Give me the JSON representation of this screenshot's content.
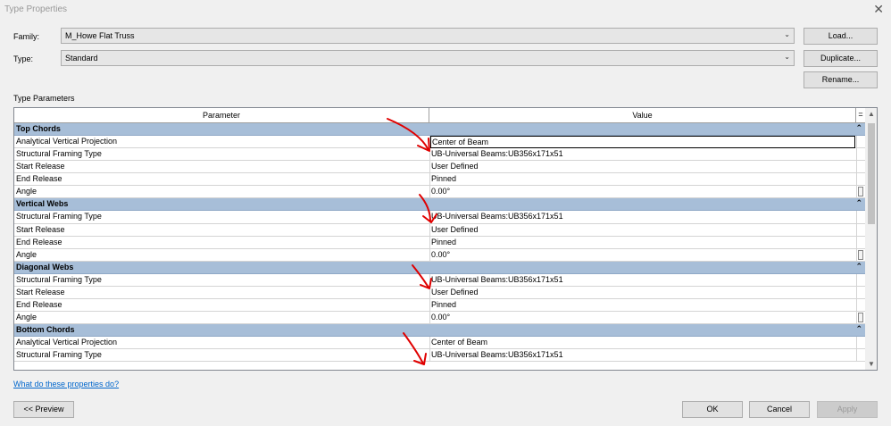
{
  "window": {
    "title": "Type Properties"
  },
  "family": {
    "label": "Family:",
    "value": "M_Howe Flat Truss",
    "load_label": "Load..."
  },
  "type": {
    "label": "Type:",
    "value": "Standard",
    "duplicate_label": "Duplicate...",
    "rename_label": "Rename..."
  },
  "type_parameters_caption": "Type Parameters",
  "grid": {
    "param_header": "Parameter",
    "value_header": "Value",
    "menu_glyph": "=",
    "groups": [
      {
        "name": "Top Chords",
        "rows": [
          {
            "param": "Analytical Vertical Projection",
            "value": "Center of Beam"
          },
          {
            "param": "Structural Framing Type",
            "value": "UB-Universal Beams:UB356x171x51"
          },
          {
            "param": "Start Release",
            "value": "User Defined"
          },
          {
            "param": "End Release",
            "value": "Pinned"
          },
          {
            "param": "Angle",
            "value": "0.00°"
          }
        ]
      },
      {
        "name": "Vertical Webs",
        "rows": [
          {
            "param": "Structural Framing Type",
            "value": "UB-Universal Beams:UB356x171x51"
          },
          {
            "param": "Start Release",
            "value": "User Defined"
          },
          {
            "param": "End Release",
            "value": "Pinned"
          },
          {
            "param": "Angle",
            "value": "0.00°"
          }
        ]
      },
      {
        "name": "Diagonal Webs",
        "rows": [
          {
            "param": "Structural Framing Type",
            "value": "UB-Universal Beams:UB356x171x51"
          },
          {
            "param": "Start Release",
            "value": "User Defined"
          },
          {
            "param": "End Release",
            "value": "Pinned"
          },
          {
            "param": "Angle",
            "value": "0.00°"
          }
        ]
      },
      {
        "name": "Bottom Chords",
        "rows": [
          {
            "param": "Analytical Vertical Projection",
            "value": "Center of Beam"
          },
          {
            "param": "Structural Framing Type",
            "value": "UB-Universal Beams:UB356x171x51"
          }
        ]
      }
    ]
  },
  "help_link": "What do these properties do?",
  "buttons": {
    "preview": "<< Preview",
    "ok": "OK",
    "cancel": "Cancel",
    "apply": "Apply"
  },
  "icons": {
    "close": "close-icon",
    "dropdown": "chevron-down-icon",
    "collapse": "collapse-up-icon"
  },
  "colors": {
    "group_header": "#a7bed8",
    "annotation_arrow": "#e00000",
    "link": "#0066cc"
  }
}
